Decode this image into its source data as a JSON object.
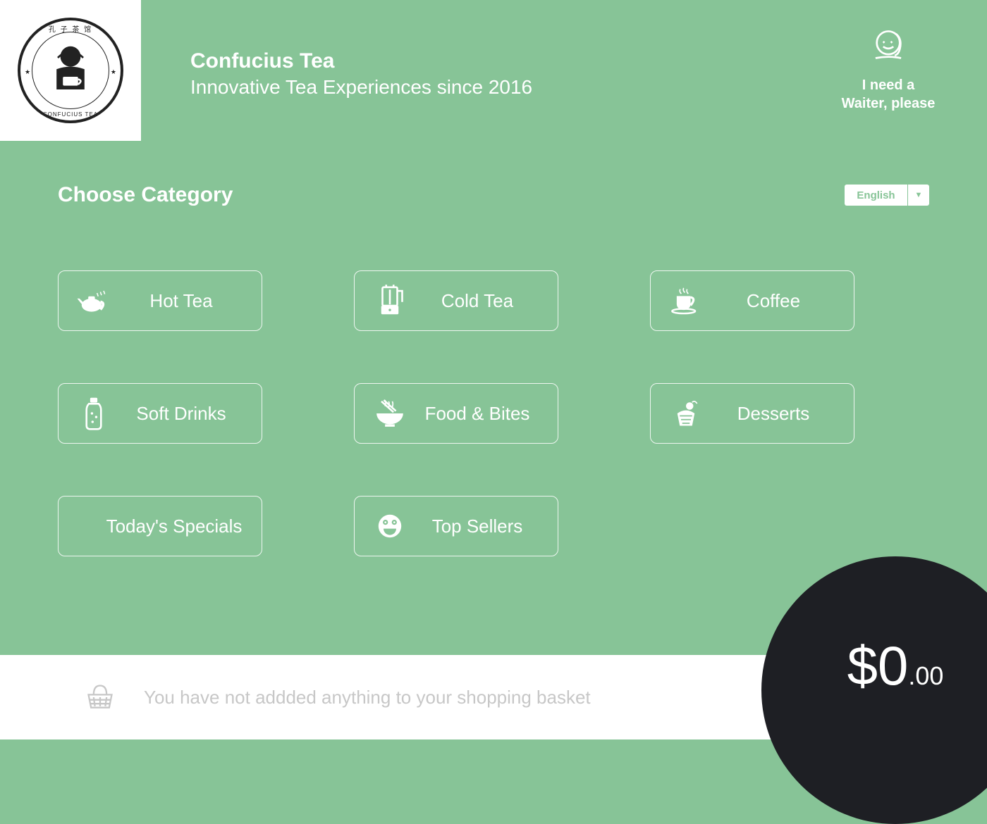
{
  "header": {
    "logo_top": "孔 子 茶 馆",
    "logo_bottom": "CONFUCIUS TEA",
    "title": "Confucius Tea",
    "subtitle": "Innovative Tea Experiences since 2016",
    "waiter_label_line1": "I need a",
    "waiter_label_line2": "Waiter, please"
  },
  "main": {
    "choose_label": "Choose  Category",
    "language": "English"
  },
  "categories": [
    {
      "label": "Hot Tea",
      "icon": "teapot-icon"
    },
    {
      "label": "Cold Tea",
      "icon": "blender-icon"
    },
    {
      "label": "Coffee",
      "icon": "coffee-cup-icon"
    },
    {
      "label": "Soft Drinks",
      "icon": "bottle-icon"
    },
    {
      "label": "Food & Bites",
      "icon": "noodle-bowl-icon"
    },
    {
      "label": "Desserts",
      "icon": "dessert-icon"
    },
    {
      "label": "Today's Specials",
      "icon": ""
    },
    {
      "label": "Top Sellers",
      "icon": "smiley-icon"
    }
  ],
  "footer": {
    "empty_basket_msg": "You have not addded anything to your shopping basket"
  },
  "cart": {
    "currency": "$",
    "total_main": "0",
    "total_cents": ".00"
  }
}
